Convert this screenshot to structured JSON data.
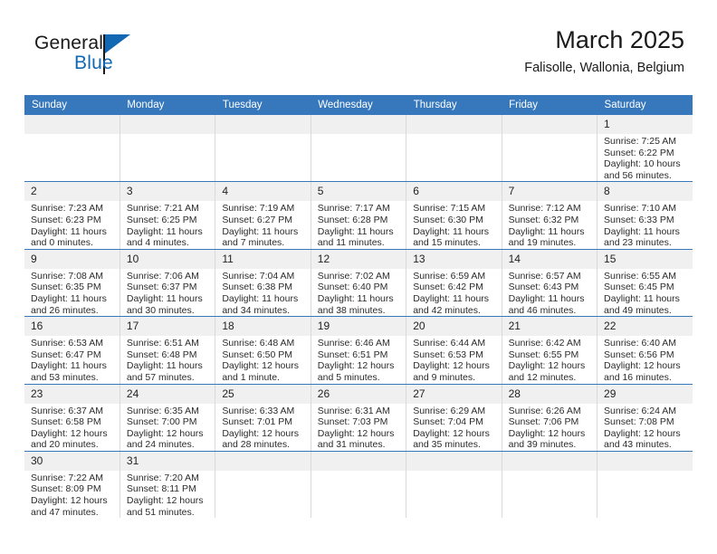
{
  "brand": {
    "name_top": "General",
    "name_bottom": "Blue",
    "accent_color": "#1268b3",
    "logo_icon": "triangle-flag-icon"
  },
  "header": {
    "title": "March 2025",
    "subtitle": "Falisolle, Wallonia, Belgium",
    "header_bg_color": "#3778bc"
  },
  "weekdays": [
    "Sunday",
    "Monday",
    "Tuesday",
    "Wednesday",
    "Thursday",
    "Friday",
    "Saturday"
  ],
  "labels": {
    "sunrise": "Sunrise:",
    "sunset": "Sunset:",
    "daylight": "Daylight:"
  },
  "weeks": [
    [
      {
        "day": "",
        "empty": true
      },
      {
        "day": "",
        "empty": true
      },
      {
        "day": "",
        "empty": true
      },
      {
        "day": "",
        "empty": true
      },
      {
        "day": "",
        "empty": true
      },
      {
        "day": "",
        "empty": true
      },
      {
        "day": "1",
        "sunrise": "Sunrise: 7:25 AM",
        "sunset": "Sunset: 6:22 PM",
        "daylight1": "Daylight: 10 hours",
        "daylight2": "and 56 minutes."
      }
    ],
    [
      {
        "day": "2",
        "sunrise": "Sunrise: 7:23 AM",
        "sunset": "Sunset: 6:23 PM",
        "daylight1": "Daylight: 11 hours",
        "daylight2": "and 0 minutes."
      },
      {
        "day": "3",
        "sunrise": "Sunrise: 7:21 AM",
        "sunset": "Sunset: 6:25 PM",
        "daylight1": "Daylight: 11 hours",
        "daylight2": "and 4 minutes."
      },
      {
        "day": "4",
        "sunrise": "Sunrise: 7:19 AM",
        "sunset": "Sunset: 6:27 PM",
        "daylight1": "Daylight: 11 hours",
        "daylight2": "and 7 minutes."
      },
      {
        "day": "5",
        "sunrise": "Sunrise: 7:17 AM",
        "sunset": "Sunset: 6:28 PM",
        "daylight1": "Daylight: 11 hours",
        "daylight2": "and 11 minutes."
      },
      {
        "day": "6",
        "sunrise": "Sunrise: 7:15 AM",
        "sunset": "Sunset: 6:30 PM",
        "daylight1": "Daylight: 11 hours",
        "daylight2": "and 15 minutes."
      },
      {
        "day": "7",
        "sunrise": "Sunrise: 7:12 AM",
        "sunset": "Sunset: 6:32 PM",
        "daylight1": "Daylight: 11 hours",
        "daylight2": "and 19 minutes."
      },
      {
        "day": "8",
        "sunrise": "Sunrise: 7:10 AM",
        "sunset": "Sunset: 6:33 PM",
        "daylight1": "Daylight: 11 hours",
        "daylight2": "and 23 minutes."
      }
    ],
    [
      {
        "day": "9",
        "sunrise": "Sunrise: 7:08 AM",
        "sunset": "Sunset: 6:35 PM",
        "daylight1": "Daylight: 11 hours",
        "daylight2": "and 26 minutes."
      },
      {
        "day": "10",
        "sunrise": "Sunrise: 7:06 AM",
        "sunset": "Sunset: 6:37 PM",
        "daylight1": "Daylight: 11 hours",
        "daylight2": "and 30 minutes."
      },
      {
        "day": "11",
        "sunrise": "Sunrise: 7:04 AM",
        "sunset": "Sunset: 6:38 PM",
        "daylight1": "Daylight: 11 hours",
        "daylight2": "and 34 minutes."
      },
      {
        "day": "12",
        "sunrise": "Sunrise: 7:02 AM",
        "sunset": "Sunset: 6:40 PM",
        "daylight1": "Daylight: 11 hours",
        "daylight2": "and 38 minutes."
      },
      {
        "day": "13",
        "sunrise": "Sunrise: 6:59 AM",
        "sunset": "Sunset: 6:42 PM",
        "daylight1": "Daylight: 11 hours",
        "daylight2": "and 42 minutes."
      },
      {
        "day": "14",
        "sunrise": "Sunrise: 6:57 AM",
        "sunset": "Sunset: 6:43 PM",
        "daylight1": "Daylight: 11 hours",
        "daylight2": "and 46 minutes."
      },
      {
        "day": "15",
        "sunrise": "Sunrise: 6:55 AM",
        "sunset": "Sunset: 6:45 PM",
        "daylight1": "Daylight: 11 hours",
        "daylight2": "and 49 minutes."
      }
    ],
    [
      {
        "day": "16",
        "sunrise": "Sunrise: 6:53 AM",
        "sunset": "Sunset: 6:47 PM",
        "daylight1": "Daylight: 11 hours",
        "daylight2": "and 53 minutes."
      },
      {
        "day": "17",
        "sunrise": "Sunrise: 6:51 AM",
        "sunset": "Sunset: 6:48 PM",
        "daylight1": "Daylight: 11 hours",
        "daylight2": "and 57 minutes."
      },
      {
        "day": "18",
        "sunrise": "Sunrise: 6:48 AM",
        "sunset": "Sunset: 6:50 PM",
        "daylight1": "Daylight: 12 hours",
        "daylight2": "and 1 minute."
      },
      {
        "day": "19",
        "sunrise": "Sunrise: 6:46 AM",
        "sunset": "Sunset: 6:51 PM",
        "daylight1": "Daylight: 12 hours",
        "daylight2": "and 5 minutes."
      },
      {
        "day": "20",
        "sunrise": "Sunrise: 6:44 AM",
        "sunset": "Sunset: 6:53 PM",
        "daylight1": "Daylight: 12 hours",
        "daylight2": "and 9 minutes."
      },
      {
        "day": "21",
        "sunrise": "Sunrise: 6:42 AM",
        "sunset": "Sunset: 6:55 PM",
        "daylight1": "Daylight: 12 hours",
        "daylight2": "and 12 minutes."
      },
      {
        "day": "22",
        "sunrise": "Sunrise: 6:40 AM",
        "sunset": "Sunset: 6:56 PM",
        "daylight1": "Daylight: 12 hours",
        "daylight2": "and 16 minutes."
      }
    ],
    [
      {
        "day": "23",
        "sunrise": "Sunrise: 6:37 AM",
        "sunset": "Sunset: 6:58 PM",
        "daylight1": "Daylight: 12 hours",
        "daylight2": "and 20 minutes."
      },
      {
        "day": "24",
        "sunrise": "Sunrise: 6:35 AM",
        "sunset": "Sunset: 7:00 PM",
        "daylight1": "Daylight: 12 hours",
        "daylight2": "and 24 minutes."
      },
      {
        "day": "25",
        "sunrise": "Sunrise: 6:33 AM",
        "sunset": "Sunset: 7:01 PM",
        "daylight1": "Daylight: 12 hours",
        "daylight2": "and 28 minutes."
      },
      {
        "day": "26",
        "sunrise": "Sunrise: 6:31 AM",
        "sunset": "Sunset: 7:03 PM",
        "daylight1": "Daylight: 12 hours",
        "daylight2": "and 31 minutes."
      },
      {
        "day": "27",
        "sunrise": "Sunrise: 6:29 AM",
        "sunset": "Sunset: 7:04 PM",
        "daylight1": "Daylight: 12 hours",
        "daylight2": "and 35 minutes."
      },
      {
        "day": "28",
        "sunrise": "Sunrise: 6:26 AM",
        "sunset": "Sunset: 7:06 PM",
        "daylight1": "Daylight: 12 hours",
        "daylight2": "and 39 minutes."
      },
      {
        "day": "29",
        "sunrise": "Sunrise: 6:24 AM",
        "sunset": "Sunset: 7:08 PM",
        "daylight1": "Daylight: 12 hours",
        "daylight2": "and 43 minutes."
      }
    ],
    [
      {
        "day": "30",
        "sunrise": "Sunrise: 7:22 AM",
        "sunset": "Sunset: 8:09 PM",
        "daylight1": "Daylight: 12 hours",
        "daylight2": "and 47 minutes."
      },
      {
        "day": "31",
        "sunrise": "Sunrise: 7:20 AM",
        "sunset": "Sunset: 8:11 PM",
        "daylight1": "Daylight: 12 hours",
        "daylight2": "and 51 minutes."
      },
      {
        "day": "",
        "empty": true
      },
      {
        "day": "",
        "empty": true
      },
      {
        "day": "",
        "empty": true
      },
      {
        "day": "",
        "empty": true
      },
      {
        "day": "",
        "empty": true
      }
    ]
  ]
}
